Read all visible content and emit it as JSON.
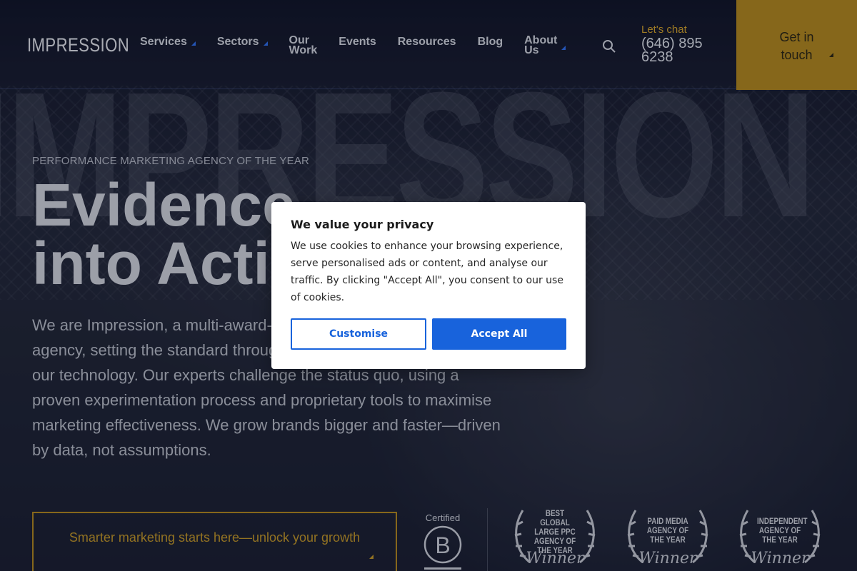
{
  "header": {
    "logo": "IMPRESSION",
    "nav": [
      {
        "label": "Services",
        "dropdown": true
      },
      {
        "label": "Sectors",
        "dropdown": true
      },
      {
        "label": "Our Work",
        "line1": "Our",
        "line2": "Work",
        "dropdown": false
      },
      {
        "label": "Events",
        "dropdown": false
      },
      {
        "label": "Resources",
        "dropdown": false
      },
      {
        "label": "Blog",
        "dropdown": false
      },
      {
        "label": "About Us",
        "line1": "About",
        "line2": "Us",
        "dropdown": true
      }
    ],
    "search_icon": "search-icon",
    "chat_label": "Let's chat",
    "phone": "(646) 895 6238",
    "cta": {
      "line1": "Get in",
      "line2": "touch"
    }
  },
  "hero": {
    "background_word": "IMPRESSION",
    "eyebrow": "PERFORMANCE MARKETING AGENCY OF THE YEAR",
    "headline_line1": "Evidence",
    "headline_line2": "into Action",
    "body": "We are Impression, a multi-award-winning performance marketing agency, setting the standard through our people, performance, and our technology. Our experts challenge the status quo, using a proven experimentation process and proprietary tools to maximise marketing effectiveness. We grow brands bigger and faster—driven by data, not assumptions.",
    "cta": "Smarter marketing starts here—unlock your growth"
  },
  "badges": {
    "bcorp": {
      "label": "Certified",
      "mark": "B"
    },
    "awards": [
      {
        "title": "BEST GLOBAL LARGE PPC AGENCY OF THE YEAR",
        "winner": "Winner"
      },
      {
        "title": "PAID MEDIA AGENCY OF THE YEAR",
        "winner": "Winner"
      },
      {
        "title": "INDEPENDENT AGENCY OF THE YEAR",
        "winner": "Winner"
      }
    ]
  },
  "cookie_modal": {
    "title": "We value your privacy",
    "text": "We use cookies to enhance your browsing experience, serve personalised ads or content, and analyse our traffic. By clicking \"Accept All\", you consent to our use of cookies.",
    "customise": "Customise",
    "accept": "Accept All"
  },
  "colors": {
    "accent_gold": "#b6891b",
    "button_blue": "#1863dc",
    "nav_caret": "#2e6ff0"
  }
}
